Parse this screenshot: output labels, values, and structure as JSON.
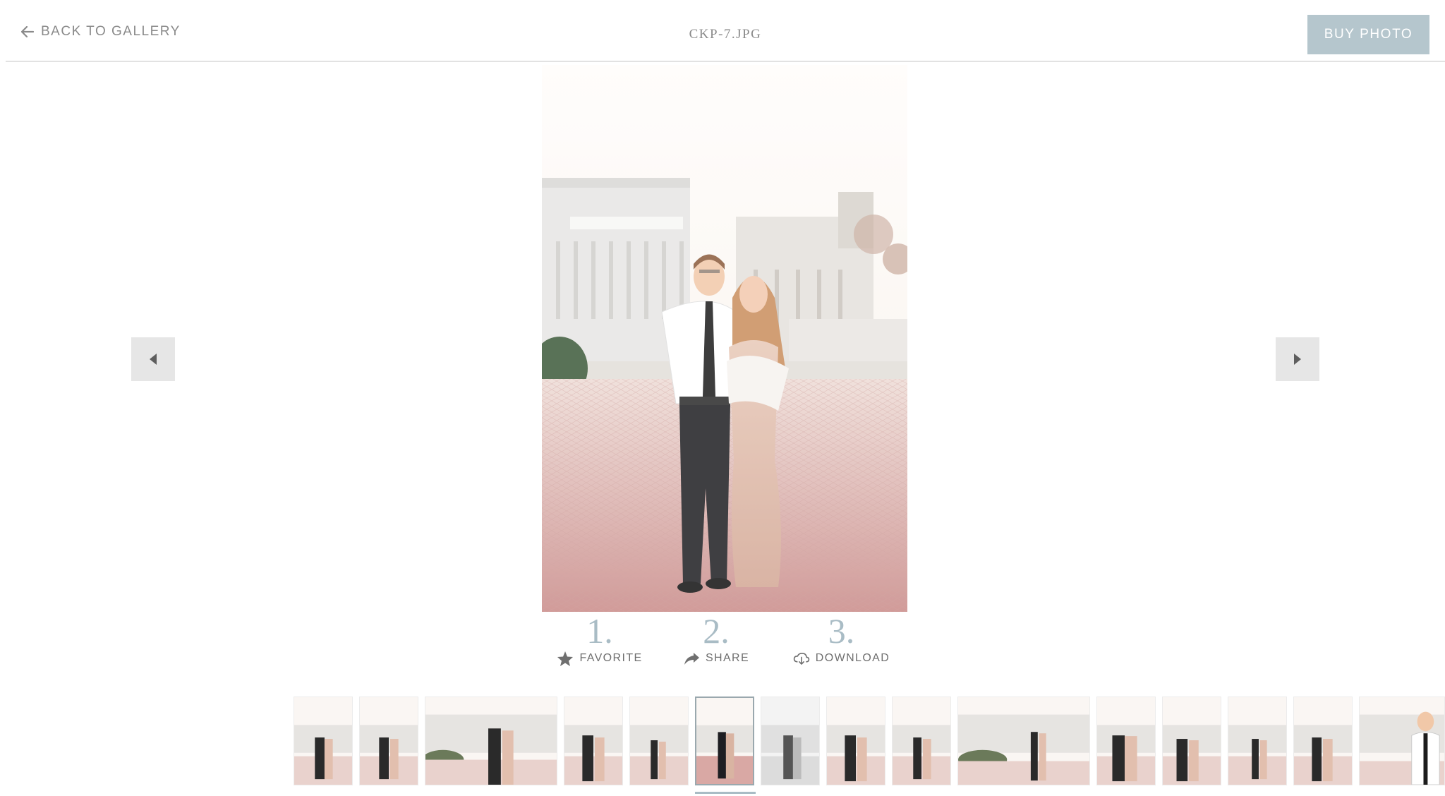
{
  "header": {
    "back_label": "BACK TO GALLERY",
    "file_name": "CKP-7.JPG",
    "buy_label": "BUY PHOTO"
  },
  "steps": [
    {
      "number": "1.",
      "label": "FAVORITE",
      "icon": "star-icon"
    },
    {
      "number": "2.",
      "label": "SHARE",
      "icon": "share-arrow-icon"
    },
    {
      "number": "3.",
      "label": "DOWNLOAD",
      "icon": "cloud-download-icon"
    }
  ],
  "colors": {
    "accent": "#a9bcc5",
    "button": "#b5c6cd",
    "arrow_bg": "#e6e6e6",
    "text": "#7a7a7a"
  },
  "filmstrip": {
    "count": 17,
    "active_index": 6
  }
}
